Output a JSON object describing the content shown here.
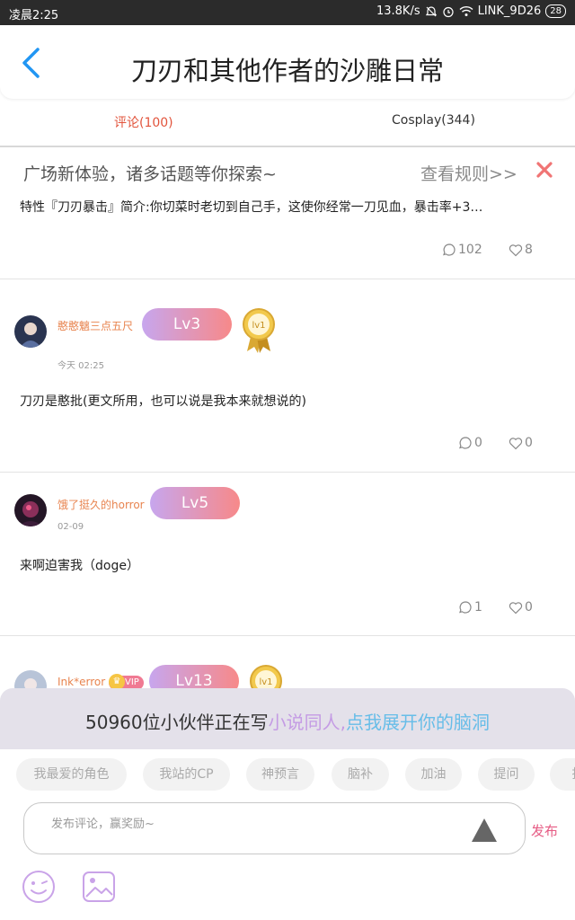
{
  "status_bar": {
    "time": "凌晨2:25",
    "network_speed": "13.8K/s",
    "wifi_name": "LINK_9D26",
    "battery": "28",
    "icons": [
      "mute-icon",
      "alarm-icon",
      "wifi-icon"
    ]
  },
  "header": {
    "title": "刀刃和其他作者的沙雕日常",
    "back_icon": "chevron-left-icon"
  },
  "tabs": [
    {
      "label": "评论(100)",
      "active": true
    },
    {
      "label": "Cosplay(344)",
      "active": false
    }
  ],
  "announcement": {
    "title": "广场新体验，诸多话题等你探索~",
    "rules_link": "查看规则>>",
    "text": "特性『刀刃暴击』简介:你切菜时老切到自己手，这使你经常一刀见血，暴击率+3…",
    "comments": "102",
    "likes": "8"
  },
  "posts": [
    {
      "username": "憨憨魑三点五尺",
      "level": "Lv3",
      "medal": "lv1",
      "time": "今天 02:25",
      "text": "刀刃是憨批(更文所用，也可以说是我本来就想说的)",
      "comments": "0",
      "likes": "0"
    },
    {
      "username": "饿了挺久的horror",
      "level": "Lv5",
      "time": "02-09",
      "text": "来啊迫害我（doge）",
      "comments": "1",
      "likes": "0"
    },
    {
      "username": "Ink*error",
      "vip": "VIP",
      "level": "Lv13",
      "medal": "lv1"
    }
  ],
  "promo": {
    "part1": "50960位小伙伴正在写",
    "part2": "小说同人,",
    "part3": "点我展开你的脑洞"
  },
  "chips": [
    "我最爱的角色",
    "我站的CP",
    "神预言",
    "脑补",
    "加油",
    "提问",
    "投"
  ],
  "comment_input": {
    "placeholder": "发布评论，赢奖励~",
    "publish_label": "发布"
  },
  "colors": {
    "accent_red": "#e2543c",
    "level_gradient_start": "#c7a6ee",
    "level_gradient_end": "#f78989",
    "username": "#e8844f",
    "promo_purple": "#c49be4",
    "promo_blue": "#67bde8",
    "publish": "#e65b84"
  }
}
